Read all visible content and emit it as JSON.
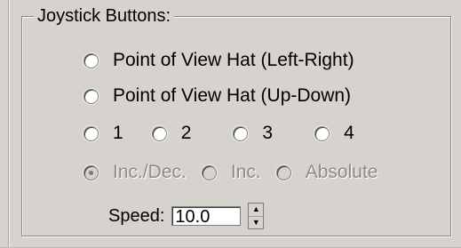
{
  "group": {
    "title": "Joystick Buttons:"
  },
  "modes": [
    {
      "label": "Point of View Hat (Left-Right)"
    },
    {
      "label": "Point of View Hat (Up-Down)"
    }
  ],
  "buttons": [
    {
      "label": "1"
    },
    {
      "label": "2"
    },
    {
      "label": "3"
    },
    {
      "label": "4"
    }
  ],
  "actions": [
    {
      "label": "Inc./Dec.",
      "checked": true,
      "disabled": true
    },
    {
      "label": "Inc.",
      "checked": false,
      "disabled": true
    },
    {
      "label": "Absolute",
      "checked": false,
      "disabled": true
    }
  ],
  "speed": {
    "label": "Speed:",
    "value": "10.0",
    "icons": [
      "spin-up-icon",
      "spin-down-icon"
    ]
  }
}
